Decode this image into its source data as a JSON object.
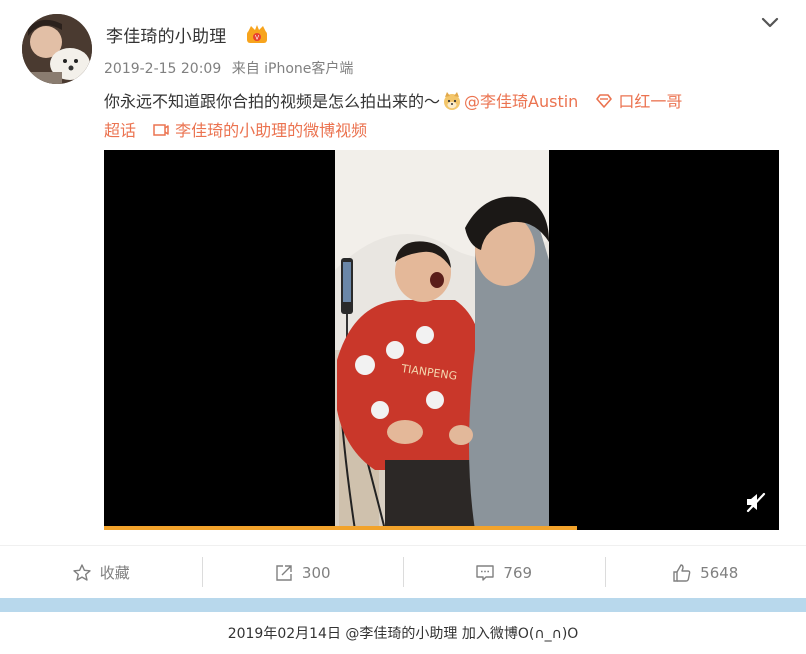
{
  "post": {
    "author": "李佳琦的小助理",
    "date": "2019-2-15 20:09",
    "source": "来自 iPhone客户端",
    "text_main": "你永远不知道跟你合拍的视频是怎么拍出来的～",
    "mention": "@李佳琦Austin",
    "topic_line1": "口红一哥",
    "topic_line2": "超话",
    "video_link": "李佳琦的小助理的微博视频",
    "video_progress": 0.7
  },
  "actions": {
    "favorite_label": "收藏",
    "repost_count": "300",
    "comment_count": "769",
    "like_count": "5648"
  },
  "footer": {
    "text": "2019年02月14日 @李佳琦的小助理 加入微博O(∩_∩)O"
  },
  "colors": {
    "link": "#eb7350",
    "progress": "#f2a32b",
    "divider_bar": "#b8d8ec"
  },
  "icons": [
    "chevron-down-icon",
    "crown-badge-icon",
    "doge-emoji-icon",
    "topic-diamond-icon",
    "video-icon",
    "mute-icon",
    "star-icon",
    "share-icon",
    "comment-icon",
    "thumbs-up-icon"
  ]
}
